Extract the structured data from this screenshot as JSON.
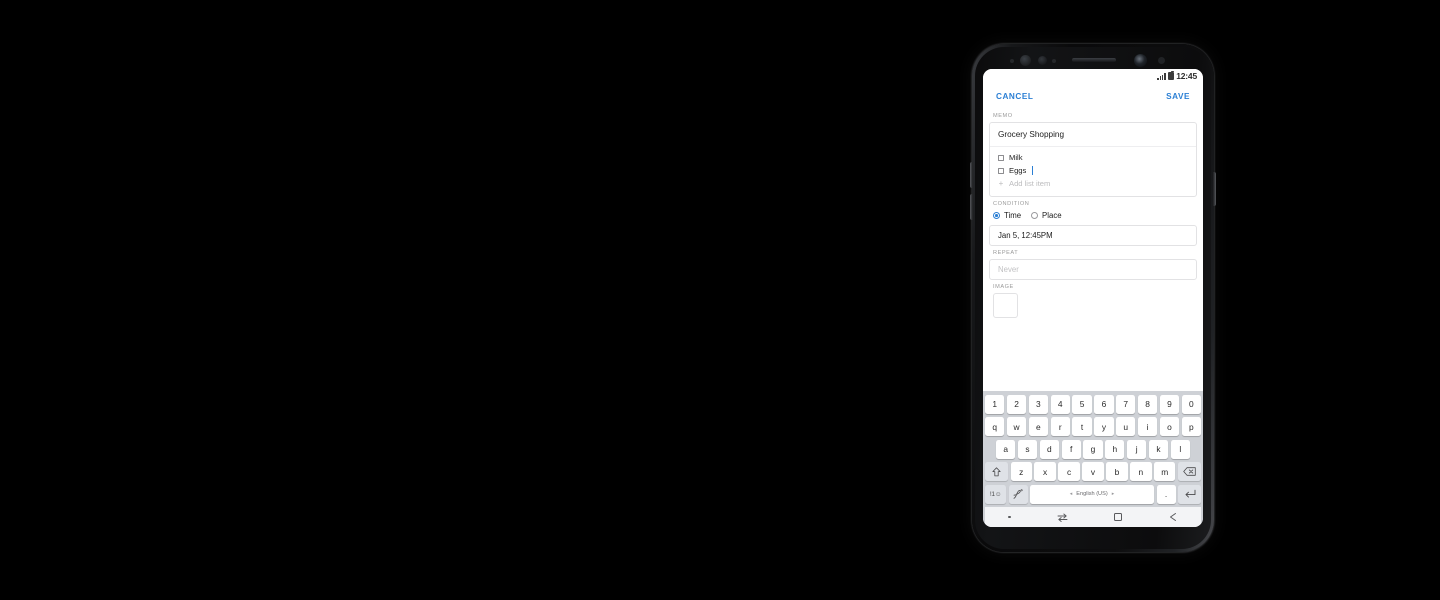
{
  "device": {
    "name": "smartphone-mockup",
    "frame_color": "#131416",
    "accent_color": "#2b7fd4"
  },
  "status_bar": {
    "time": "12:45",
    "signal_icon": "signal-bars-icon",
    "battery_icon": "battery-icon"
  },
  "action_bar": {
    "cancel_label": "CANCEL",
    "save_label": "SAVE"
  },
  "memo": {
    "section_label": "MEMO",
    "title": "Grocery Shopping",
    "items": [
      {
        "label": "Milk",
        "checked": false
      },
      {
        "label": "Eggs",
        "checked": false
      }
    ],
    "add_item_label": "Add list item",
    "add_item_icon": "plus-icon"
  },
  "condition": {
    "section_label": "CONDITION",
    "options": [
      {
        "label": "Time",
        "selected": true
      },
      {
        "label": "Place",
        "selected": false
      }
    ],
    "datetime_value": "Jan 5, 12:45PM"
  },
  "repeat": {
    "section_label": "REPEAT",
    "placeholder": "Never"
  },
  "image": {
    "section_label": "IMAGE"
  },
  "keyboard": {
    "row_numbers": [
      "1",
      "2",
      "3",
      "4",
      "5",
      "6",
      "7",
      "8",
      "9",
      "0"
    ],
    "row_top": [
      "q",
      "w",
      "e",
      "r",
      "t",
      "y",
      "u",
      "i",
      "o",
      "p"
    ],
    "row_home": [
      "a",
      "s",
      "d",
      "f",
      "g",
      "h",
      "j",
      "k",
      "l"
    ],
    "row_bottom": [
      "z",
      "x",
      "c",
      "v",
      "b",
      "n",
      "m"
    ],
    "shift_icon": "shift-arrow-icon",
    "backspace_icon": "backspace-icon",
    "symbols_label": "!1☺",
    "handwriting_icon": "handwriting-pen-icon",
    "space_label": "English (US)",
    "space_left_arrow": "◂",
    "space_right_arrow": "▸",
    "period_label": ".",
    "enter_icon": "enter-return-icon"
  },
  "nav_bar": {
    "items": [
      {
        "icon": "dot-indicator-icon"
      },
      {
        "icon": "recents-swap-icon"
      },
      {
        "icon": "home-square-icon"
      },
      {
        "icon": "back-arrow-icon"
      }
    ]
  }
}
